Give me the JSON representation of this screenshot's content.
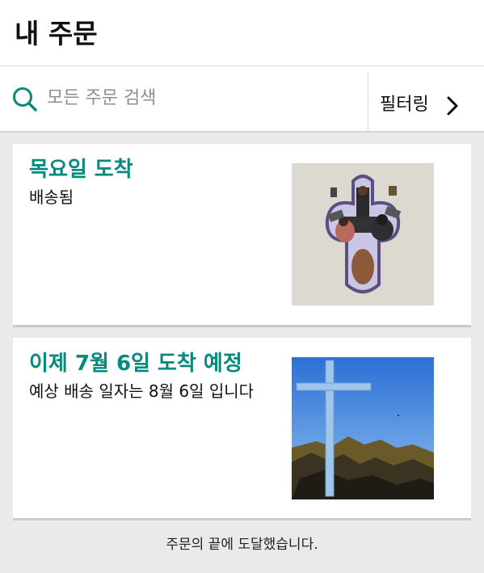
{
  "header": {
    "title": "내 주문"
  },
  "search": {
    "placeholder": "모든 주문 검색",
    "icon": "search-icon"
  },
  "filter": {
    "label": "필터링",
    "icon": "chevron-right-icon"
  },
  "orders": [
    {
      "title": "목요일 도착",
      "status": "배송됨"
    },
    {
      "title": "이제 7월 6일 도착 예정",
      "status": "예상 배송 일자는 8월 6일 입니다"
    }
  ],
  "footer": {
    "text": "주문의 끝에 도달했습니다."
  },
  "colors": {
    "accent": "#058a7d",
    "background": "#e9eaeb"
  }
}
